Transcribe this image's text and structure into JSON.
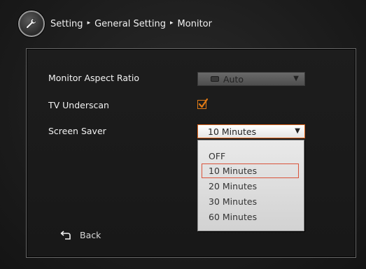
{
  "breadcrumb": {
    "items": [
      "Setting",
      "General Setting",
      "Monitor"
    ],
    "separator": "▸"
  },
  "settings": {
    "aspect_ratio": {
      "label": "Monitor Aspect Ratio",
      "value": "Auto"
    },
    "tv_underscan": {
      "label": "TV Underscan",
      "checked": true
    },
    "screen_saver": {
      "label": "Screen Saver",
      "value": "10 Minutes",
      "options": [
        "OFF",
        "10 Minutes",
        "20 Minutes",
        "30 Minutes",
        "60 Minutes"
      ],
      "highlighted_index": 1
    }
  },
  "footer": {
    "back_label": "Back"
  },
  "colors": {
    "accent": "#e07a16",
    "highlight_border": "#d9533a",
    "panel_border": "#6a6a6a"
  },
  "icons": {
    "settings_icon": "wrench-icon",
    "back_icon": "back-arrow-icon",
    "aspect_icon": "aspect-ratio-icon",
    "dropdown_arrow": "triangle-down-icon"
  }
}
